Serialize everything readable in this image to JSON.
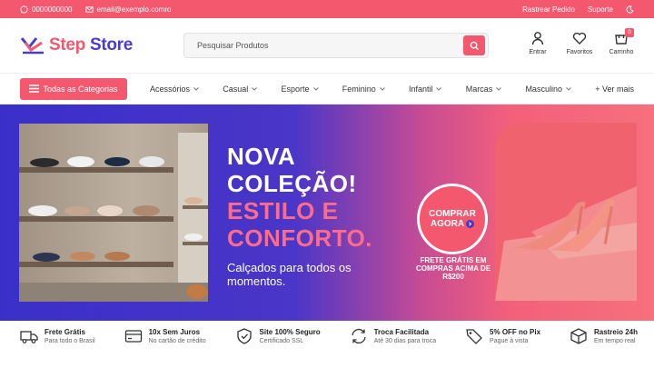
{
  "topbar": {
    "phone": "0000000000",
    "email": "email@exemplo.comro",
    "track": "Rastrear Pedido",
    "support": "Suporte"
  },
  "logo": {
    "part1": "Step",
    "part2": " Store"
  },
  "search": {
    "placeholder": "Pesquisar Produtos"
  },
  "actions": {
    "account": "Entrar",
    "favorites": "Favoritos",
    "cart": "Carrinho",
    "cart_count": "0"
  },
  "nav": {
    "categories_label": "Todas as Categorias",
    "items": [
      "Acessórios",
      "Casual",
      "Esporte",
      "Feminino",
      "Infantil",
      "Marcas",
      "Masculino"
    ],
    "more": "+ Ver mais"
  },
  "hero": {
    "line1": "NOVA",
    "line2": "COLEÇÃO!",
    "line3": "ESTILO E",
    "line4": "CONFORTO.",
    "subtitle": "Calçados para todos os momentos.",
    "cta_line1": "COMPRAR",
    "cta_line2": "AGORA",
    "shipping": "FRETE GRÁTIS EM COMPRAS ACIMA DE R$200"
  },
  "features": [
    {
      "title": "Frete Grátis",
      "sub": "Para todo o Brasil",
      "icon": "truck-icon"
    },
    {
      "title": "10x Sem Juros",
      "sub": "No cartão de crédito",
      "icon": "credit-card-icon"
    },
    {
      "title": "Site 100% Seguro",
      "sub": "Certificado SSL",
      "icon": "shield-icon"
    },
    {
      "title": "Troca Facilitada",
      "sub": "Até 30 dias para troca",
      "icon": "exchange-icon"
    },
    {
      "title": "5% OFF no Pix",
      "sub": "Pague à vista",
      "icon": "tag-icon"
    },
    {
      "title": "Rastreio 24h",
      "sub": "Em tempo real",
      "icon": "box-icon"
    }
  ],
  "colors": {
    "primary": "#f3586f",
    "brand": "#4a3bd6"
  }
}
